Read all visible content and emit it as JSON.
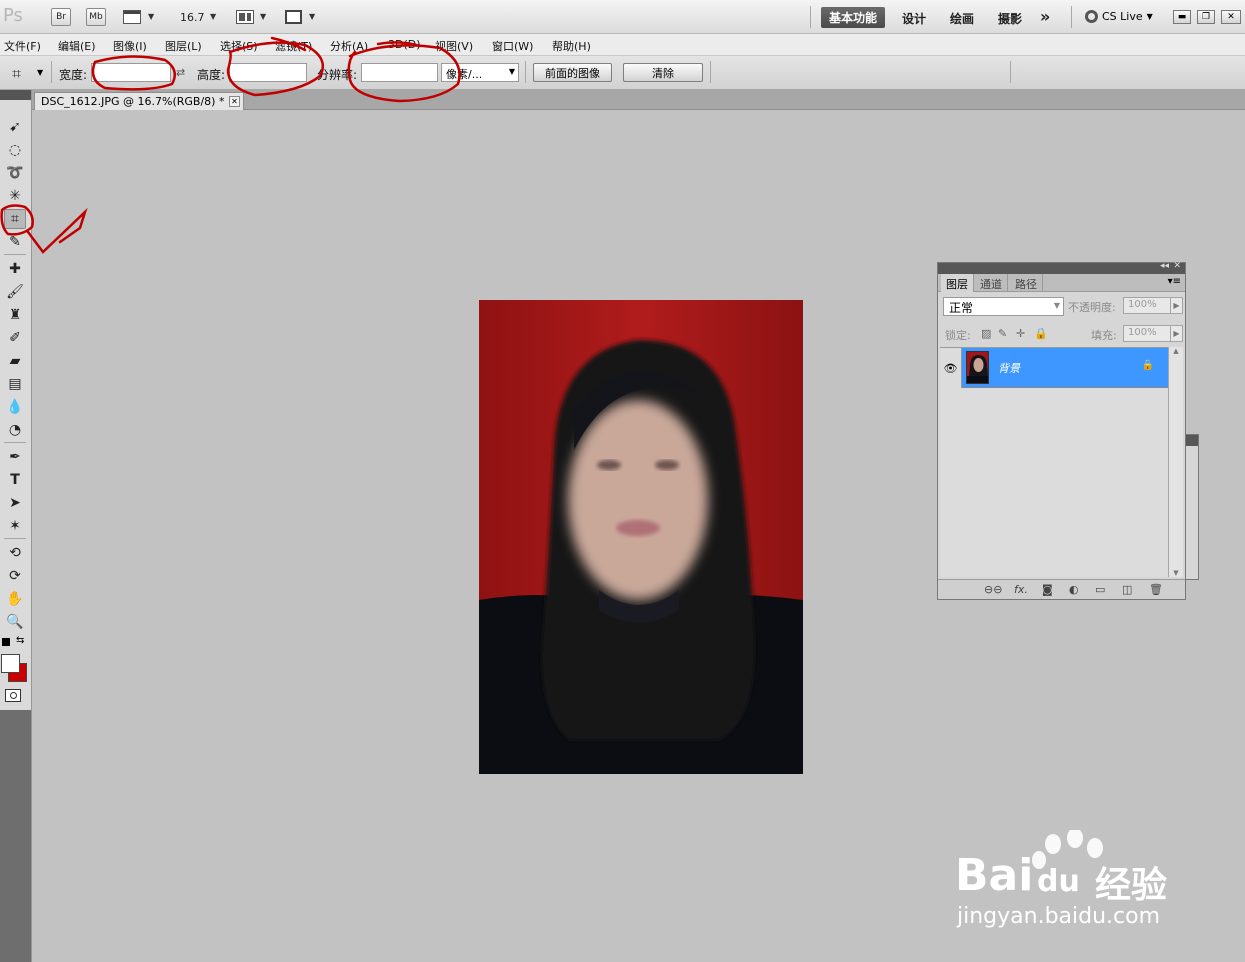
{
  "app": {
    "logo": "Ps",
    "bridge_label": "Br",
    "minibridge_label": "Mb",
    "zoom": "16.7",
    "workspaces": [
      "基本功能",
      "设计",
      "绘画",
      "摄影"
    ],
    "more_workspaces": "»",
    "cs_live": "CS Live"
  },
  "menubar": {
    "items": [
      "文件(F)",
      "编辑(E)",
      "图像(I)",
      "图层(L)",
      "选择(S)",
      "滤镜(T)",
      "分析(A)",
      "3D(D)",
      "视图(V)",
      "窗口(W)",
      "帮助(H)"
    ]
  },
  "options": {
    "width_label": "宽度:",
    "width_value": "",
    "height_label": "高度:",
    "height_value": "",
    "resolution_label": "分辨率:",
    "resolution_value": "",
    "unit_value": "像素/...",
    "front_image_button": "前面的图像",
    "clear_button": "清除"
  },
  "document": {
    "tab_title": "DSC_1612.JPG @ 16.7%(RGB/8) *"
  },
  "layers_panel": {
    "tabs": [
      "图层",
      "通道",
      "路径"
    ],
    "blend_mode": "正常",
    "opacity_label": "不透明度:",
    "opacity_value": "100%",
    "lock_label": "锁定:",
    "fill_label": "填充:",
    "fill_value": "100%",
    "layers": [
      {
        "name": "背景",
        "visible": true,
        "locked": true,
        "selected": true
      }
    ]
  },
  "colors": {
    "selected_layer": "#3d97ff",
    "annotation": "#c00000",
    "photo_background": "#a81818",
    "background_swatch": "#cc0000"
  },
  "watermark": {
    "brand": "Bai",
    "paw_text": "du",
    "brand_cn": "经验",
    "url": "jingyan.baidu.com"
  }
}
